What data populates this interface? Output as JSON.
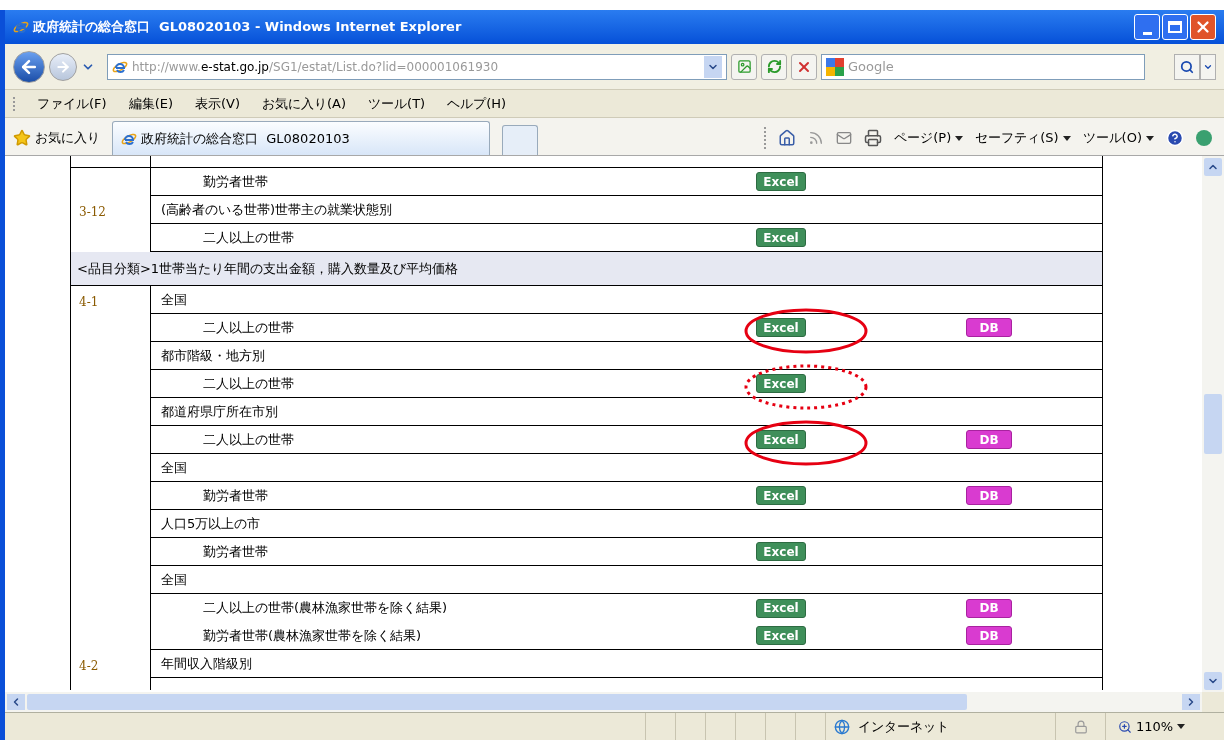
{
  "window": {
    "title": "政府統計の総合窓口  GL08020103 - Windows Internet Explorer"
  },
  "address_bar": {
    "url_prefix": "http://www.",
    "url_host": "e-stat.go.jp",
    "url_path": "/SG1/estat/List.do?lid=000001061930"
  },
  "search": {
    "placeholder": "Google"
  },
  "menu": [
    "ファイル(F)",
    "編集(E)",
    "表示(V)",
    "お気に入り(A)",
    "ツール(T)",
    "ヘルプ(H)"
  ],
  "favorites": {
    "label": "お気に入り"
  },
  "tab": {
    "title": "政府統計の総合窓口  GL08020103"
  },
  "command_bar": [
    "ページ(P)",
    "セーフティ(S)",
    "ツール(O)"
  ],
  "table": {
    "groups": [
      {
        "kind": "group",
        "rows": [
          {
            "kind": "item",
            "text": "勤労者世帯",
            "excel": "Excel",
            "joined": false
          }
        ]
      },
      {
        "kind": "group",
        "code": "3-12",
        "rows": [
          {
            "kind": "heading",
            "text": "(高齢者のいる世帯)世帯主の就業状態別"
          },
          {
            "kind": "item",
            "text": "二人以上の世帯",
            "excel": "Excel",
            "joined": false
          }
        ]
      },
      {
        "kind": "band",
        "text": "<品目分類>1世帯当たり年間の支出金額，購入数量及び平均価格"
      },
      {
        "kind": "group",
        "code": "4-1",
        "rows": [
          {
            "kind": "heading",
            "text": "全国"
          },
          {
            "kind": "item",
            "text": "二人以上の世帯",
            "excel": "Excel",
            "db": "DB",
            "circled": true,
            "dotted": false,
            "joined": false
          },
          {
            "kind": "heading",
            "text": "都市階級・地方別"
          },
          {
            "kind": "item",
            "text": "二人以上の世帯",
            "excel": "Excel",
            "circled": true,
            "dotted": true,
            "joined": false
          },
          {
            "kind": "heading",
            "text": "都道府県庁所在市別"
          },
          {
            "kind": "item",
            "text": "二人以上の世帯",
            "excel": "Excel",
            "db": "DB",
            "circled": true,
            "dotted": false,
            "joined": false
          },
          {
            "kind": "heading",
            "text": "全国"
          },
          {
            "kind": "item",
            "text": "勤労者世帯",
            "excel": "Excel",
            "db": "DB",
            "joined": false
          },
          {
            "kind": "heading",
            "text": "人口5万以上の市"
          },
          {
            "kind": "item",
            "text": "勤労者世帯",
            "excel": "Excel",
            "joined": false
          },
          {
            "kind": "heading",
            "text": "全国"
          },
          {
            "kind": "item",
            "text": "二人以上の世帯(農林漁家世帯を除く結果)",
            "excel": "Excel",
            "db": "DB",
            "joined": true
          },
          {
            "kind": "item",
            "text": "勤労者世帯(農林漁家世帯を除く結果)",
            "excel": "Excel",
            "db": "DB",
            "joined": false
          }
        ]
      },
      {
        "kind": "group",
        "code": "4-2",
        "rows": [
          {
            "kind": "heading",
            "text": "年間収入階級別"
          }
        ]
      }
    ]
  },
  "status_bar": {
    "zone": "インターネット",
    "zoom": "110%"
  }
}
